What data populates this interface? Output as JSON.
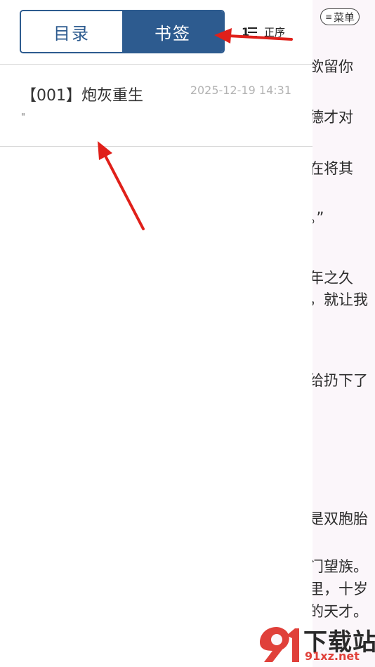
{
  "reader": {
    "menu_label": "菜单",
    "menu_icon": "menu-lines-icon",
    "lines": [
      "欲留你",
      "德才对",
      "在将其",
      "。”",
      "年之久",
      "，就让我",
      "给扔下了",
      "是双胞胎",
      "门望族。",
      "里，十岁",
      "的天才。"
    ]
  },
  "drawer": {
    "tabs": [
      {
        "label": "目录",
        "active": false
      },
      {
        "label": "书签",
        "active": true
      }
    ],
    "sort": {
      "icon": "sort-order-icon",
      "label": "正序"
    },
    "bookmarks": [
      {
        "title": "【001】炮灰重生",
        "time": "2025-12-19 14:31",
        "excerpt": "\""
      }
    ]
  },
  "watermark": {
    "text": "下载站",
    "url": "91xz.net"
  },
  "colors": {
    "accent": "#2d5b8f",
    "arrow": "#e0201a",
    "divider": "#d8d8d8",
    "time_gray": "#b3b3b3"
  }
}
